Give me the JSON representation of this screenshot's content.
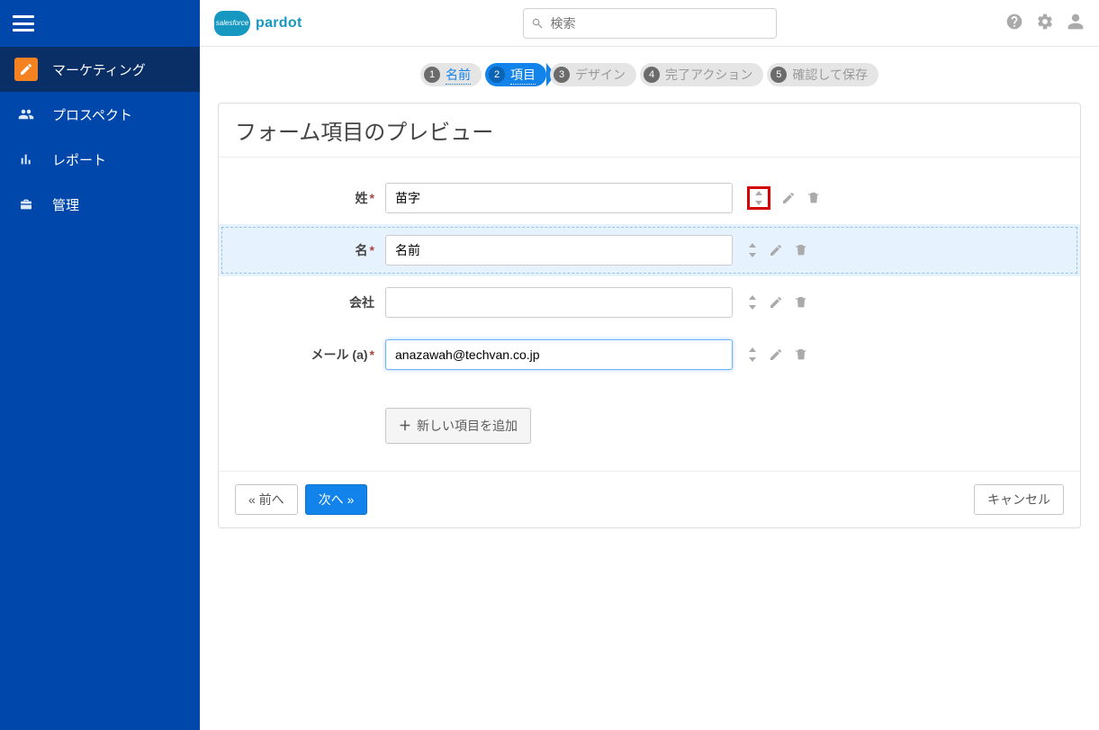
{
  "brand": {
    "cloud_text": "salesforce",
    "product": "pardot"
  },
  "search": {
    "placeholder": "検索"
  },
  "sidebar": {
    "items": [
      {
        "label": "マーケティング"
      },
      {
        "label": "プロスペクト"
      },
      {
        "label": "レポート"
      },
      {
        "label": "管理"
      }
    ]
  },
  "steps": [
    {
      "num": "1",
      "label": "名前"
    },
    {
      "num": "2",
      "label": "項目"
    },
    {
      "num": "3",
      "label": "デザイン"
    },
    {
      "num": "4",
      "label": "完了アクション"
    },
    {
      "num": "5",
      "label": "確認して保存"
    }
  ],
  "panel": {
    "title": "フォーム項目のプレビュー",
    "fields": [
      {
        "label": "姓",
        "required": true,
        "value": "苗字"
      },
      {
        "label": "名",
        "required": true,
        "value": "名前"
      },
      {
        "label": "会社",
        "required": false,
        "value": ""
      },
      {
        "label": "メール (a)",
        "required": true,
        "value": "anazawah@techvan.co.jp"
      }
    ],
    "add_btn": "新しい項目を追加",
    "prev": "« 前へ",
    "next": "次へ »",
    "cancel": "キャンセル"
  }
}
